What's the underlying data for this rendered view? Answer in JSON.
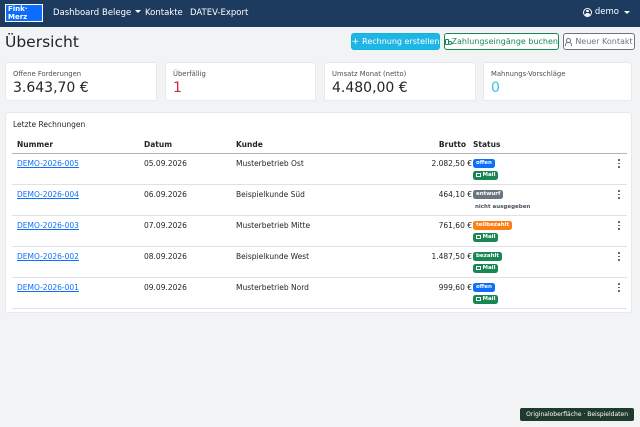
{
  "navbar": {
    "logo_line1": "Fink·",
    "logo_line2": "Merz",
    "items": [
      {
        "label": "Dashboard"
      },
      {
        "label": "Belege"
      },
      {
        "label": "Kontakte"
      },
      {
        "label": "DATEV-Export"
      }
    ],
    "user": "demo"
  },
  "page": {
    "title": "Übersicht",
    "actions": {
      "new_invoice": "Rechnung erstellen",
      "book_payments": "Zahlungseingänge buchen",
      "new_contact": "Neuer Kontakt"
    }
  },
  "kpis": [
    {
      "label": "Offene Forderungen",
      "value": "3.643,70 €"
    },
    {
      "label": "Überfällig",
      "value": "1"
    },
    {
      "label": "Umsatz Monat (netto)",
      "value": "4.480,00 €"
    },
    {
      "label": "Mahnungs-Vorschläge",
      "value": "0"
    }
  ],
  "invoices": {
    "title": "Letzte Rechnungen",
    "columns": [
      "Nummer",
      "Datum",
      "Kunde",
      "Brutto",
      "Status"
    ],
    "rows": [
      {
        "number": "DEMO-2026-005",
        "date": "05.09.2026",
        "customer": "Musterbetrieb Ost",
        "gross": "2.082,50 €",
        "status": "offen",
        "sub": "Mail"
      },
      {
        "number": "DEMO-2026-004",
        "date": "06.09.2026",
        "customer": "Beispielkunde Süd",
        "gross": "464,10 €",
        "status": "entwurf",
        "sub": "nicht ausgegeben"
      },
      {
        "number": "DEMO-2026-003",
        "date": "07.09.2026",
        "customer": "Musterbetrieb Mitte",
        "gross": "761,60 €",
        "status": "teilbezahlt",
        "sub": "Mail"
      },
      {
        "number": "DEMO-2026-002",
        "date": "08.09.2026",
        "customer": "Beispielkunde West",
        "gross": "1.487,50 €",
        "status": "bezahlt",
        "sub": "Mail"
      },
      {
        "number": "DEMO-2026-001",
        "date": "09.09.2026",
        "customer": "Musterbetrieb Nord",
        "gross": "999,60 €",
        "status": "offen",
        "sub": "Mail"
      }
    ]
  },
  "status_colors": {
    "offen": "#0d6efd",
    "entwurf": "#6c757d",
    "teilbezahlt": "#fd7e14",
    "bezahlt": "#198754",
    "mail": "#198754"
  },
  "footer": {
    "badge": "Originaloberfläche · Beispieldaten"
  }
}
